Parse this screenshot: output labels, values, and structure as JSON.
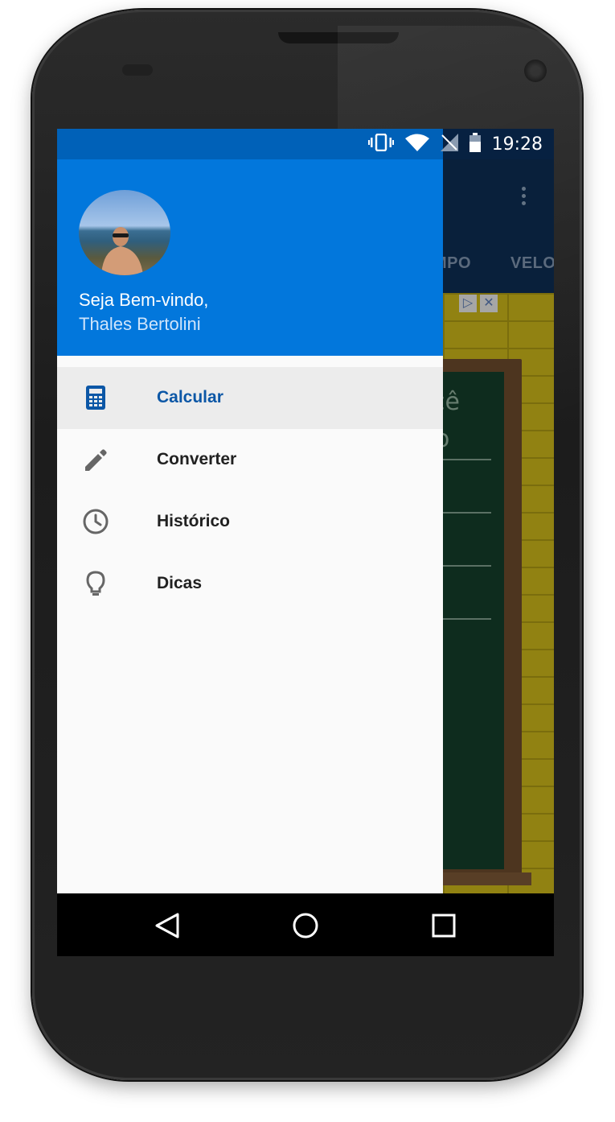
{
  "status_bar": {
    "time": "19:28",
    "icons": [
      "vibrate-icon",
      "wifi-icon",
      "no-signal-icon",
      "battery-icon"
    ]
  },
  "background_app": {
    "tabs": [
      "MPO",
      "VELO"
    ],
    "board_text": [
      "cê",
      "o"
    ]
  },
  "drawer": {
    "header": {
      "greeting": "Seja Bem-vindo,",
      "user_name": "Thales Bertolini"
    },
    "menu": [
      {
        "label": "Calcular",
        "icon": "calculator-icon",
        "active": true
      },
      {
        "label": "Converter",
        "icon": "pencil-icon",
        "active": false
      },
      {
        "label": "Histórico",
        "icon": "clock-icon",
        "active": false
      },
      {
        "label": "Dicas",
        "icon": "lightbulb-icon",
        "active": false
      }
    ]
  },
  "nav_bar": {
    "buttons": [
      "back-icon",
      "home-icon",
      "recents-icon"
    ]
  },
  "colors": {
    "drawer_header": "#0277dc",
    "drawer_status": "#0061b8",
    "active_item_text": "#0c57a6",
    "active_item_bg": "#ececec"
  }
}
